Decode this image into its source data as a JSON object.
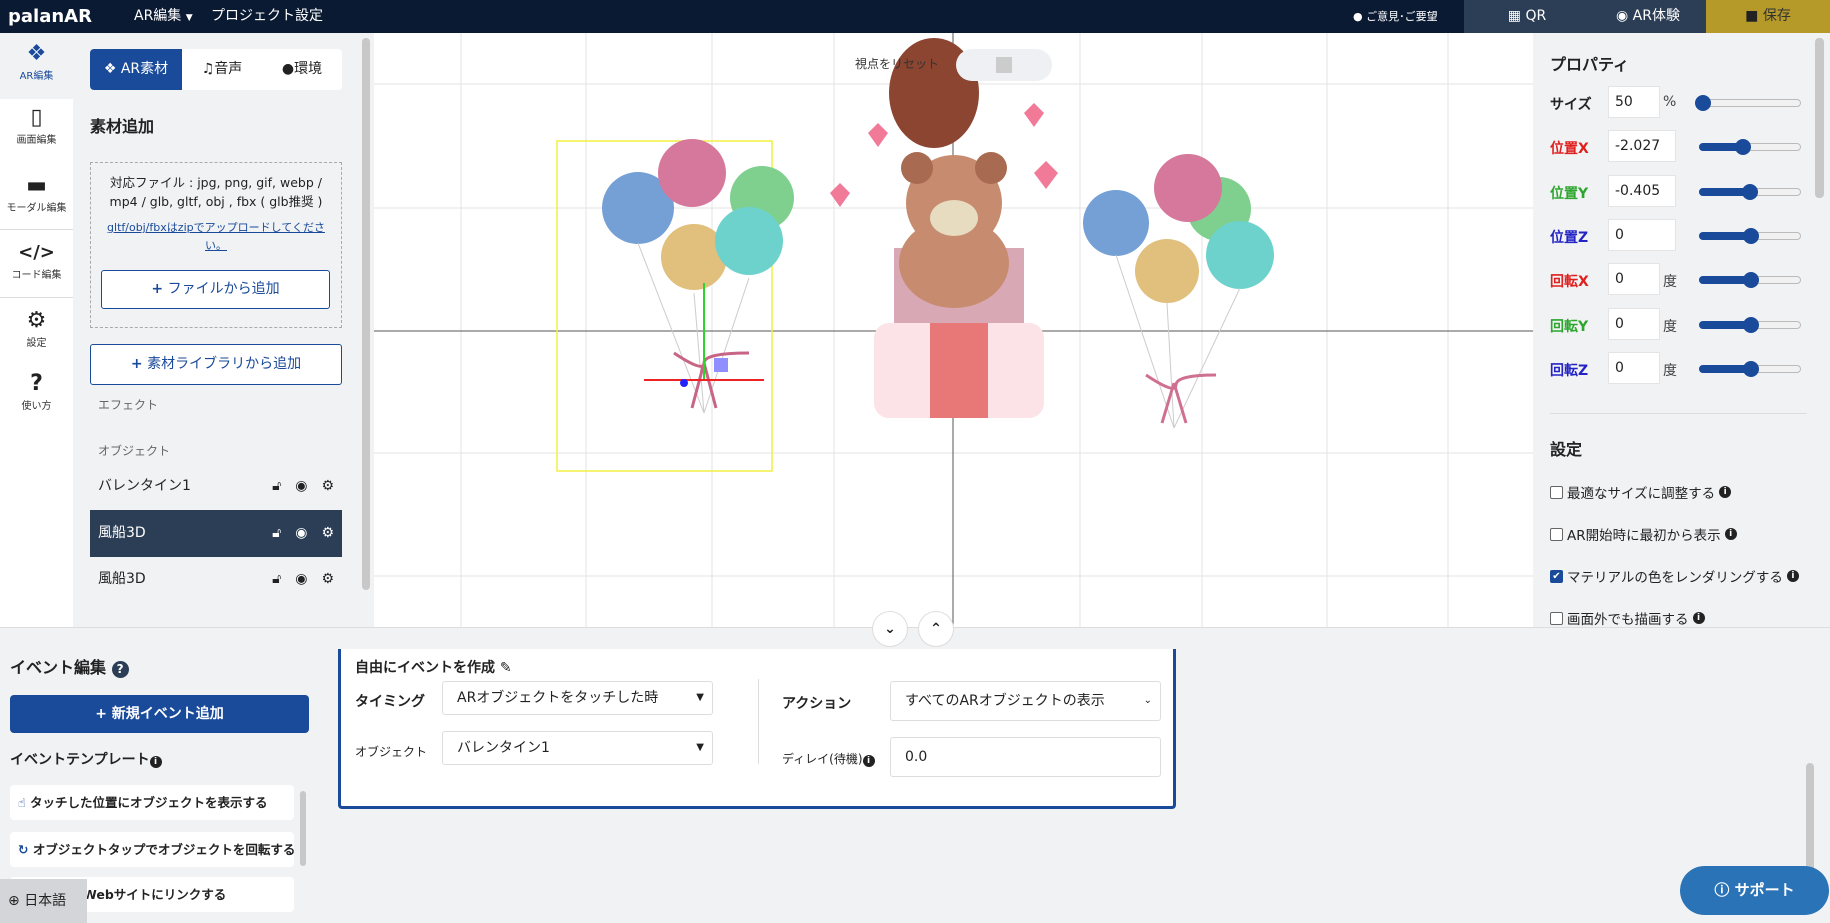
{
  "topbar": {
    "logo": "palanAR",
    "menu_ar_edit": "AR編集",
    "menu_project": "プロジェクト設定",
    "feedback": "ご意見･ご要望",
    "qr": "QR",
    "ar_experience": "AR体験",
    "save": "保存"
  },
  "rail": [
    {
      "label": "AR編集",
      "icon": "cubes-icon"
    },
    {
      "label": "画面編集",
      "icon": "mobile-icon"
    },
    {
      "label": "モーダル編集",
      "icon": "comment-icon"
    },
    {
      "label": "コード編集",
      "icon": "code-icon"
    },
    {
      "label": "設定",
      "icon": "gear-icon"
    },
    {
      "label": "使い方",
      "icon": "question-icon"
    }
  ],
  "left": {
    "tabs": [
      "AR素材",
      "音声",
      "環境"
    ],
    "heading": "素材追加",
    "supported": "対応ファイル : jpg, png, gif, webp / mp4 / glb, gltf, obj , fbx ( glb推奨 )",
    "zip_note": "gltf/obj/fbxはzipでアップロードしてください。",
    "add_file": "ファイルから追加",
    "add_library": "素材ライブラリから追加",
    "effect": "エフェクト",
    "object": "オブジェクト",
    "objects": [
      "バレンタイン1",
      "風船3D",
      "風船3D"
    ],
    "selected_index": 1
  },
  "viewport": {
    "reset_view": "視点をリセット"
  },
  "props": {
    "title": "プロパティ",
    "rows": [
      {
        "label": "サイズ",
        "value": "50",
        "unit": "%",
        "color": "#222222",
        "slider": 0.03
      },
      {
        "label": "位置X",
        "value": "-2.027",
        "unit": "",
        "color": "#e0201f",
        "slider": 0.42
      },
      {
        "label": "位置Y",
        "value": "-0.405",
        "unit": "",
        "color": "#2ea52e",
        "slider": 0.49
      },
      {
        "label": "位置Z",
        "value": "0",
        "unit": "",
        "color": "#2424c4",
        "slider": 0.5
      },
      {
        "label": "回転X",
        "value": "0",
        "unit": "度",
        "color": "#e0201f",
        "slider": 0.5
      },
      {
        "label": "回転Y",
        "value": "0",
        "unit": "度",
        "color": "#2ea52e",
        "slider": 0.5
      },
      {
        "label": "回転Z",
        "value": "0",
        "unit": "度",
        "color": "#2424c4",
        "slider": 0.5
      }
    ],
    "settings_title": "設定",
    "settings": [
      {
        "label": "最適なサイズに調整する",
        "checked": false
      },
      {
        "label": "AR開始時に最初から表示",
        "checked": false
      },
      {
        "label": "マテリアルの色をレンダリングする",
        "checked": true
      },
      {
        "label": "画面外でも描画する",
        "checked": false
      }
    ]
  },
  "events": {
    "title": "イベント編集",
    "new_event": "新規イベント追加",
    "template_title": "イベントテンプレート",
    "templates": [
      "タッチした位置にオブジェクトを表示する",
      "オブジェクトタップでオブジェクトを回転する",
      "オブジェクトタップでWebサイトにリンクする"
    ],
    "card": {
      "title": "自由にイベントを作成",
      "timing_label": "タイミング",
      "timing_value": "ARオブジェクトをタッチした時",
      "object_label": "オブジェクト",
      "object_value": "バレンタイン1",
      "action_label": "アクション",
      "action_value": "すべてのARオブジェクトの表示",
      "delay_label": "ディレイ(待機)",
      "delay_value": "0.0"
    }
  },
  "language": "日本語",
  "support": "サポート"
}
